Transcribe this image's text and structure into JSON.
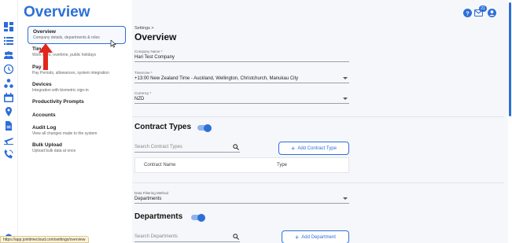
{
  "page_heading": "Overview",
  "rail_icons": [
    "dashboard-icon",
    "list-icon",
    "people-icon",
    "clock-icon",
    "org-chart-icon",
    "calendar-icon",
    "location-pin-icon",
    "document-icon",
    "flight-icon",
    "phone-icon",
    "gear-icon"
  ],
  "nav": {
    "items": [
      {
        "title": "Overview",
        "subtitle": "Company details, departments & roles"
      },
      {
        "title": "Time",
        "subtitle": "Work days, overtime, public holidays"
      },
      {
        "title": "Pay",
        "subtitle": "Pay Periods, allowances, system integration"
      },
      {
        "title": "Devices",
        "subtitle": "Integration with biometric sign-in"
      },
      {
        "title": "Productivity Prompts",
        "subtitle": ""
      },
      {
        "title": "Accounts",
        "subtitle": ""
      },
      {
        "title": "Audit Log",
        "subtitle": "View all changes made to the system"
      },
      {
        "title": "Bulk Upload",
        "subtitle": "Upload bulk data at once"
      }
    ]
  },
  "main": {
    "breadcrumb": "Settings >",
    "title": "Overview",
    "company_name": {
      "label": "Company Name *",
      "value": "Hari Test Company"
    },
    "timezone": {
      "label": "Timezone *",
      "value": "+13:00 New Zealand Time - Auckland, Wellington, Christchurch, Manukau City"
    },
    "currency": {
      "label": "Currency *",
      "value": "NZD"
    },
    "contract_types": {
      "title": "Contract Types",
      "toggle_on": true,
      "search_placeholder": "Search Contract Types",
      "add_label": "Add Contract Type",
      "columns": [
        "Contract Name",
        "Type"
      ]
    },
    "data_filtering": {
      "label": "Data Filtering Method",
      "value": "Departments"
    },
    "departments": {
      "title": "Departments",
      "toggle_on": true,
      "search_placeholder": "Search Departments",
      "add_label": "Add Department"
    }
  },
  "header": {
    "notification_count": "21"
  },
  "status_bar": {
    "url": "https://app.jointimecloud.com/settings/overview"
  },
  "colors": {
    "accent": "#2d6fd6",
    "annotation": "#e3261c"
  }
}
